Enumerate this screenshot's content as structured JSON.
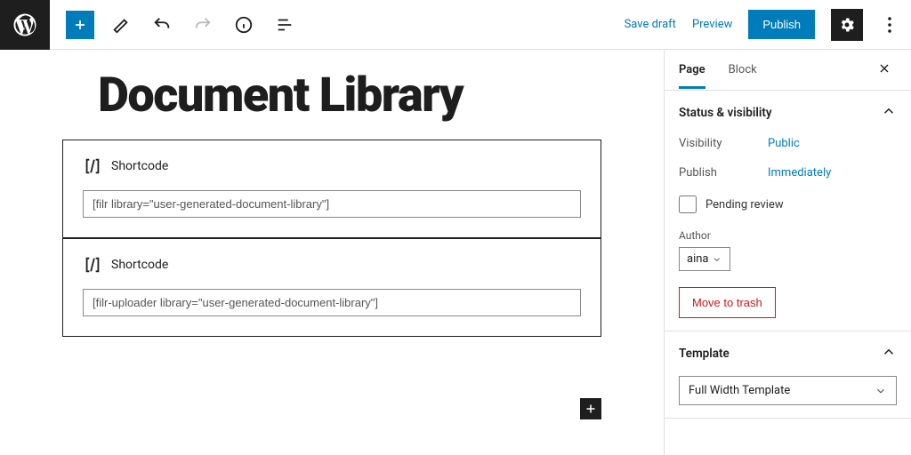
{
  "toolbar": {
    "save_draft": "Save draft",
    "preview": "Preview",
    "publish": "Publish"
  },
  "editor": {
    "title": "Document Library",
    "blocks": [
      {
        "label": "Shortcode",
        "value": "[filr library=\"user-generated-document-library\"]"
      },
      {
        "label": "Shortcode",
        "value": "[filr-uploader library=\"user-generated-document-library\"]"
      }
    ]
  },
  "sidebar": {
    "tabs": {
      "page": "Page",
      "block": "Block"
    },
    "status": {
      "title": "Status & visibility",
      "visibility_label": "Visibility",
      "visibility_value": "Public",
      "publish_label": "Publish",
      "publish_value": "Immediately",
      "pending_review": "Pending review",
      "author_label": "Author",
      "author_value": "aina",
      "trash": "Move to trash"
    },
    "template": {
      "title": "Template",
      "value": "Full Width Template"
    }
  }
}
